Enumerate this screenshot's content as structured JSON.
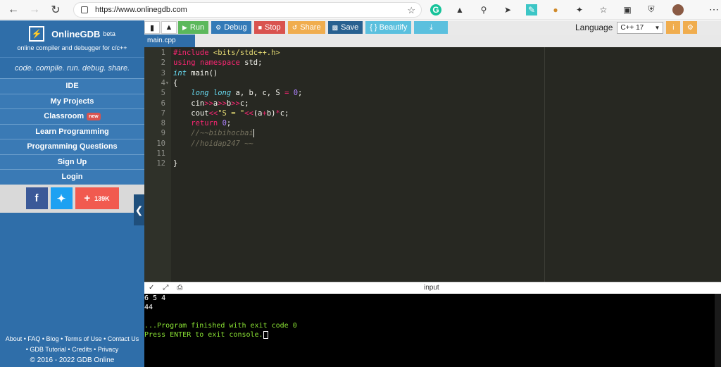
{
  "browser": {
    "url": "https://www.onlinegdb.com"
  },
  "sidebar": {
    "brand_name": "OnlineGDB",
    "brand_beta": "beta",
    "brand_sub": "online compiler and debugger for c/c++",
    "tagline": "code. compile. run. debug. share.",
    "items": [
      {
        "label": "IDE"
      },
      {
        "label": "My Projects"
      },
      {
        "label": "Classroom",
        "badge": "new"
      },
      {
        "label": "Learn Programming"
      },
      {
        "label": "Programming Questions"
      },
      {
        "label": "Sign Up"
      },
      {
        "label": "Login"
      }
    ],
    "social": {
      "facebook": "f",
      "twitter": "t",
      "plus_count": "139K"
    },
    "footer": {
      "line1": "About • FAQ • Blog • Terms of Use • Contact Us",
      "line2": "• GDB Tutorial • Credits • Privacy",
      "copyright": "© 2016 - 2022 GDB Online"
    }
  },
  "toolbar": {
    "run": "Run",
    "debug": "Debug",
    "stop": "Stop",
    "share": "Share",
    "save": "Save",
    "beautify": "{ } Beautify",
    "language_label": "Language",
    "language_value": "C++ 17"
  },
  "editor": {
    "tab": "main.cpp",
    "line_numbers": [
      "1",
      "2",
      "3",
      "4",
      "5",
      "6",
      "7",
      "8",
      "9",
      "10",
      "11",
      "12"
    ]
  },
  "console": {
    "label": "input",
    "lines": [
      "6 5 4",
      "44",
      "",
      "...Program finished with exit code 0",
      "Press ENTER to exit console."
    ]
  },
  "colors": {
    "sidebar": "#2f6ea9",
    "editor_bg": "#272822",
    "run": "#5cb85c",
    "stop": "#d9534f",
    "share": "#f0ad4e"
  }
}
